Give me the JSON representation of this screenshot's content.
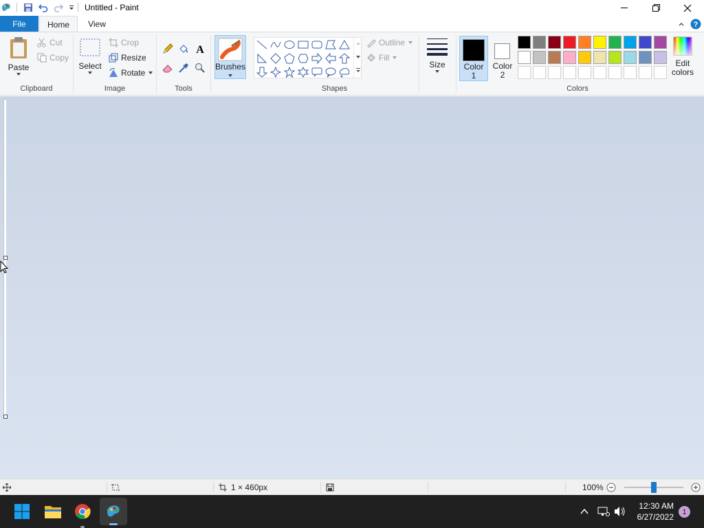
{
  "window": {
    "title": "Untitled - Paint",
    "icons": [
      "paint-app-icon",
      "save-icon",
      "undo-icon",
      "redo-icon",
      "customize-qa-icon"
    ]
  },
  "tabs": {
    "file": "File",
    "home": "Home",
    "view": "View"
  },
  "clipboard": {
    "paste": "Paste",
    "cut": "Cut",
    "copy": "Copy",
    "group": "Clipboard"
  },
  "image": {
    "select": "Select",
    "crop": "Crop",
    "resize": "Resize",
    "rotate": "Rotate",
    "group": "Image"
  },
  "tools": {
    "group": "Tools",
    "items": [
      "pencil-icon",
      "fill-icon",
      "text-icon",
      "eraser-icon",
      "color-picker-icon",
      "magnifier-icon"
    ]
  },
  "brushes": {
    "label": "Brushes"
  },
  "shapes": {
    "outline": "Outline",
    "fill": "Fill",
    "group": "Shapes",
    "items": [
      "line",
      "curve",
      "oval",
      "rectangle",
      "rounded-rectangle",
      "polygon",
      "triangle",
      "right-triangle",
      "diamond",
      "pentagon",
      "hexagon",
      "right-arrow",
      "left-arrow",
      "up-arrow",
      "down-arrow",
      "four-point-star",
      "five-point-star",
      "six-point-star",
      "rounded-callout",
      "oval-callout",
      "cloud-callout"
    ]
  },
  "size": {
    "label": "Size"
  },
  "colors": {
    "color1": "Color",
    "color1_num": "1",
    "color2": "Color",
    "color2_num": "2",
    "edit": "Edit",
    "edit2": "colors",
    "group": "Colors",
    "color1_value": "#000000",
    "color2_value": "#ffffff",
    "palette_row1": [
      "#000000",
      "#7f7f7f",
      "#880015",
      "#ed1c24",
      "#ff7f27",
      "#fff200",
      "#22b14c",
      "#00a2e8",
      "#3f48cc",
      "#a349a4"
    ],
    "palette_row2": [
      "#ffffff",
      "#c3c3c3",
      "#b97a57",
      "#ffaec9",
      "#ffc90e",
      "#efe4b0",
      "#b5e61d",
      "#99d9ea",
      "#7092be",
      "#c8bfe7"
    ]
  },
  "status": {
    "selection_size": "1 × 460px",
    "zoom": "100%",
    "zoom_fraction": 0.5
  },
  "taskbar": {
    "time": "12:30 AM",
    "date": "6/27/2022",
    "notifications": "1",
    "icons": [
      "windows-start-icon",
      "file-explorer-icon",
      "chrome-icon",
      "paint-taskbar-icon"
    ]
  }
}
